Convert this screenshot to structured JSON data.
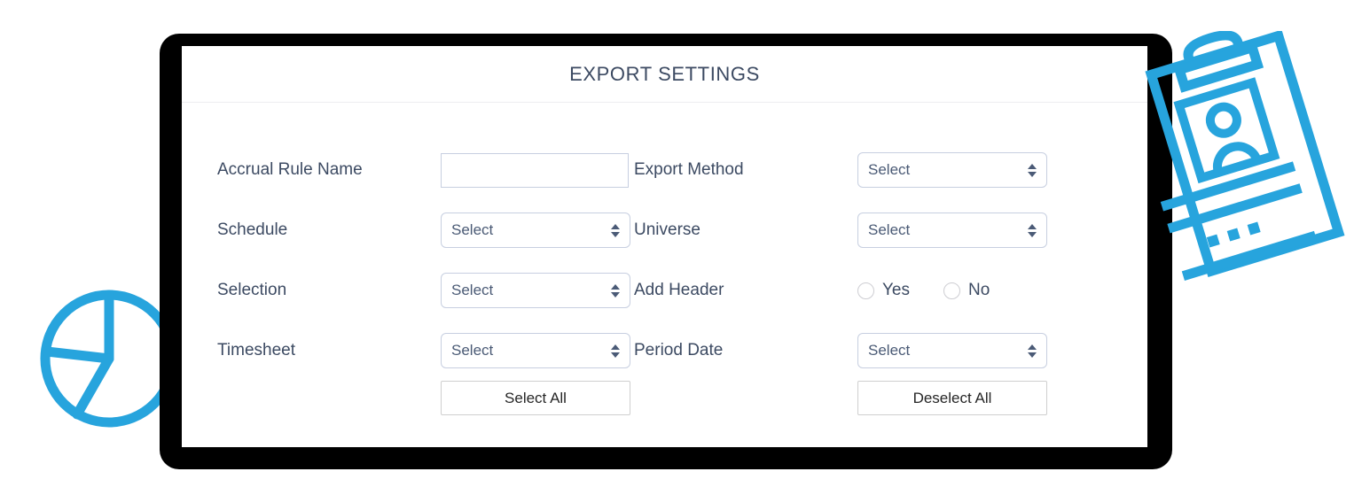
{
  "panel": {
    "title": "EXPORT SETTINGS"
  },
  "form": {
    "left_column": [
      {
        "label": "Accrual Rule Name",
        "control": "text",
        "value": "",
        "placeholder": ""
      },
      {
        "label": "Schedule",
        "control": "select",
        "value": "Select"
      },
      {
        "label": "Selection",
        "control": "select",
        "value": "Select"
      },
      {
        "label": "Timesheet",
        "control": "select",
        "value": "Select"
      }
    ],
    "right_column": [
      {
        "label": "Export Method",
        "control": "select",
        "value": "Select"
      },
      {
        "label": "Universe",
        "control": "select",
        "value": "Select"
      },
      {
        "label": "Add Header",
        "control": "radio",
        "options": [
          {
            "label": "Yes",
            "selected": false
          },
          {
            "label": "No",
            "selected": false
          }
        ]
      },
      {
        "label": "Period Date",
        "control": "select",
        "value": "Select"
      }
    ]
  },
  "actions": {
    "select_all": "Select All",
    "deselect_all": "Deselect All"
  },
  "decorations": {
    "pie_chart_icon": "pie-chart-icon",
    "clipboard_icon": "clipboard-profile-icon",
    "accent_color": "#27A4DD",
    "bezel_color": "#000000"
  },
  "colors": {
    "label_text": "#3C4A62",
    "title_text": "#3C4A62",
    "select_border": "#C7CFE0",
    "button_border": "#CFCFCF",
    "button_text": "#262626",
    "divider": "#EDEDF0"
  }
}
